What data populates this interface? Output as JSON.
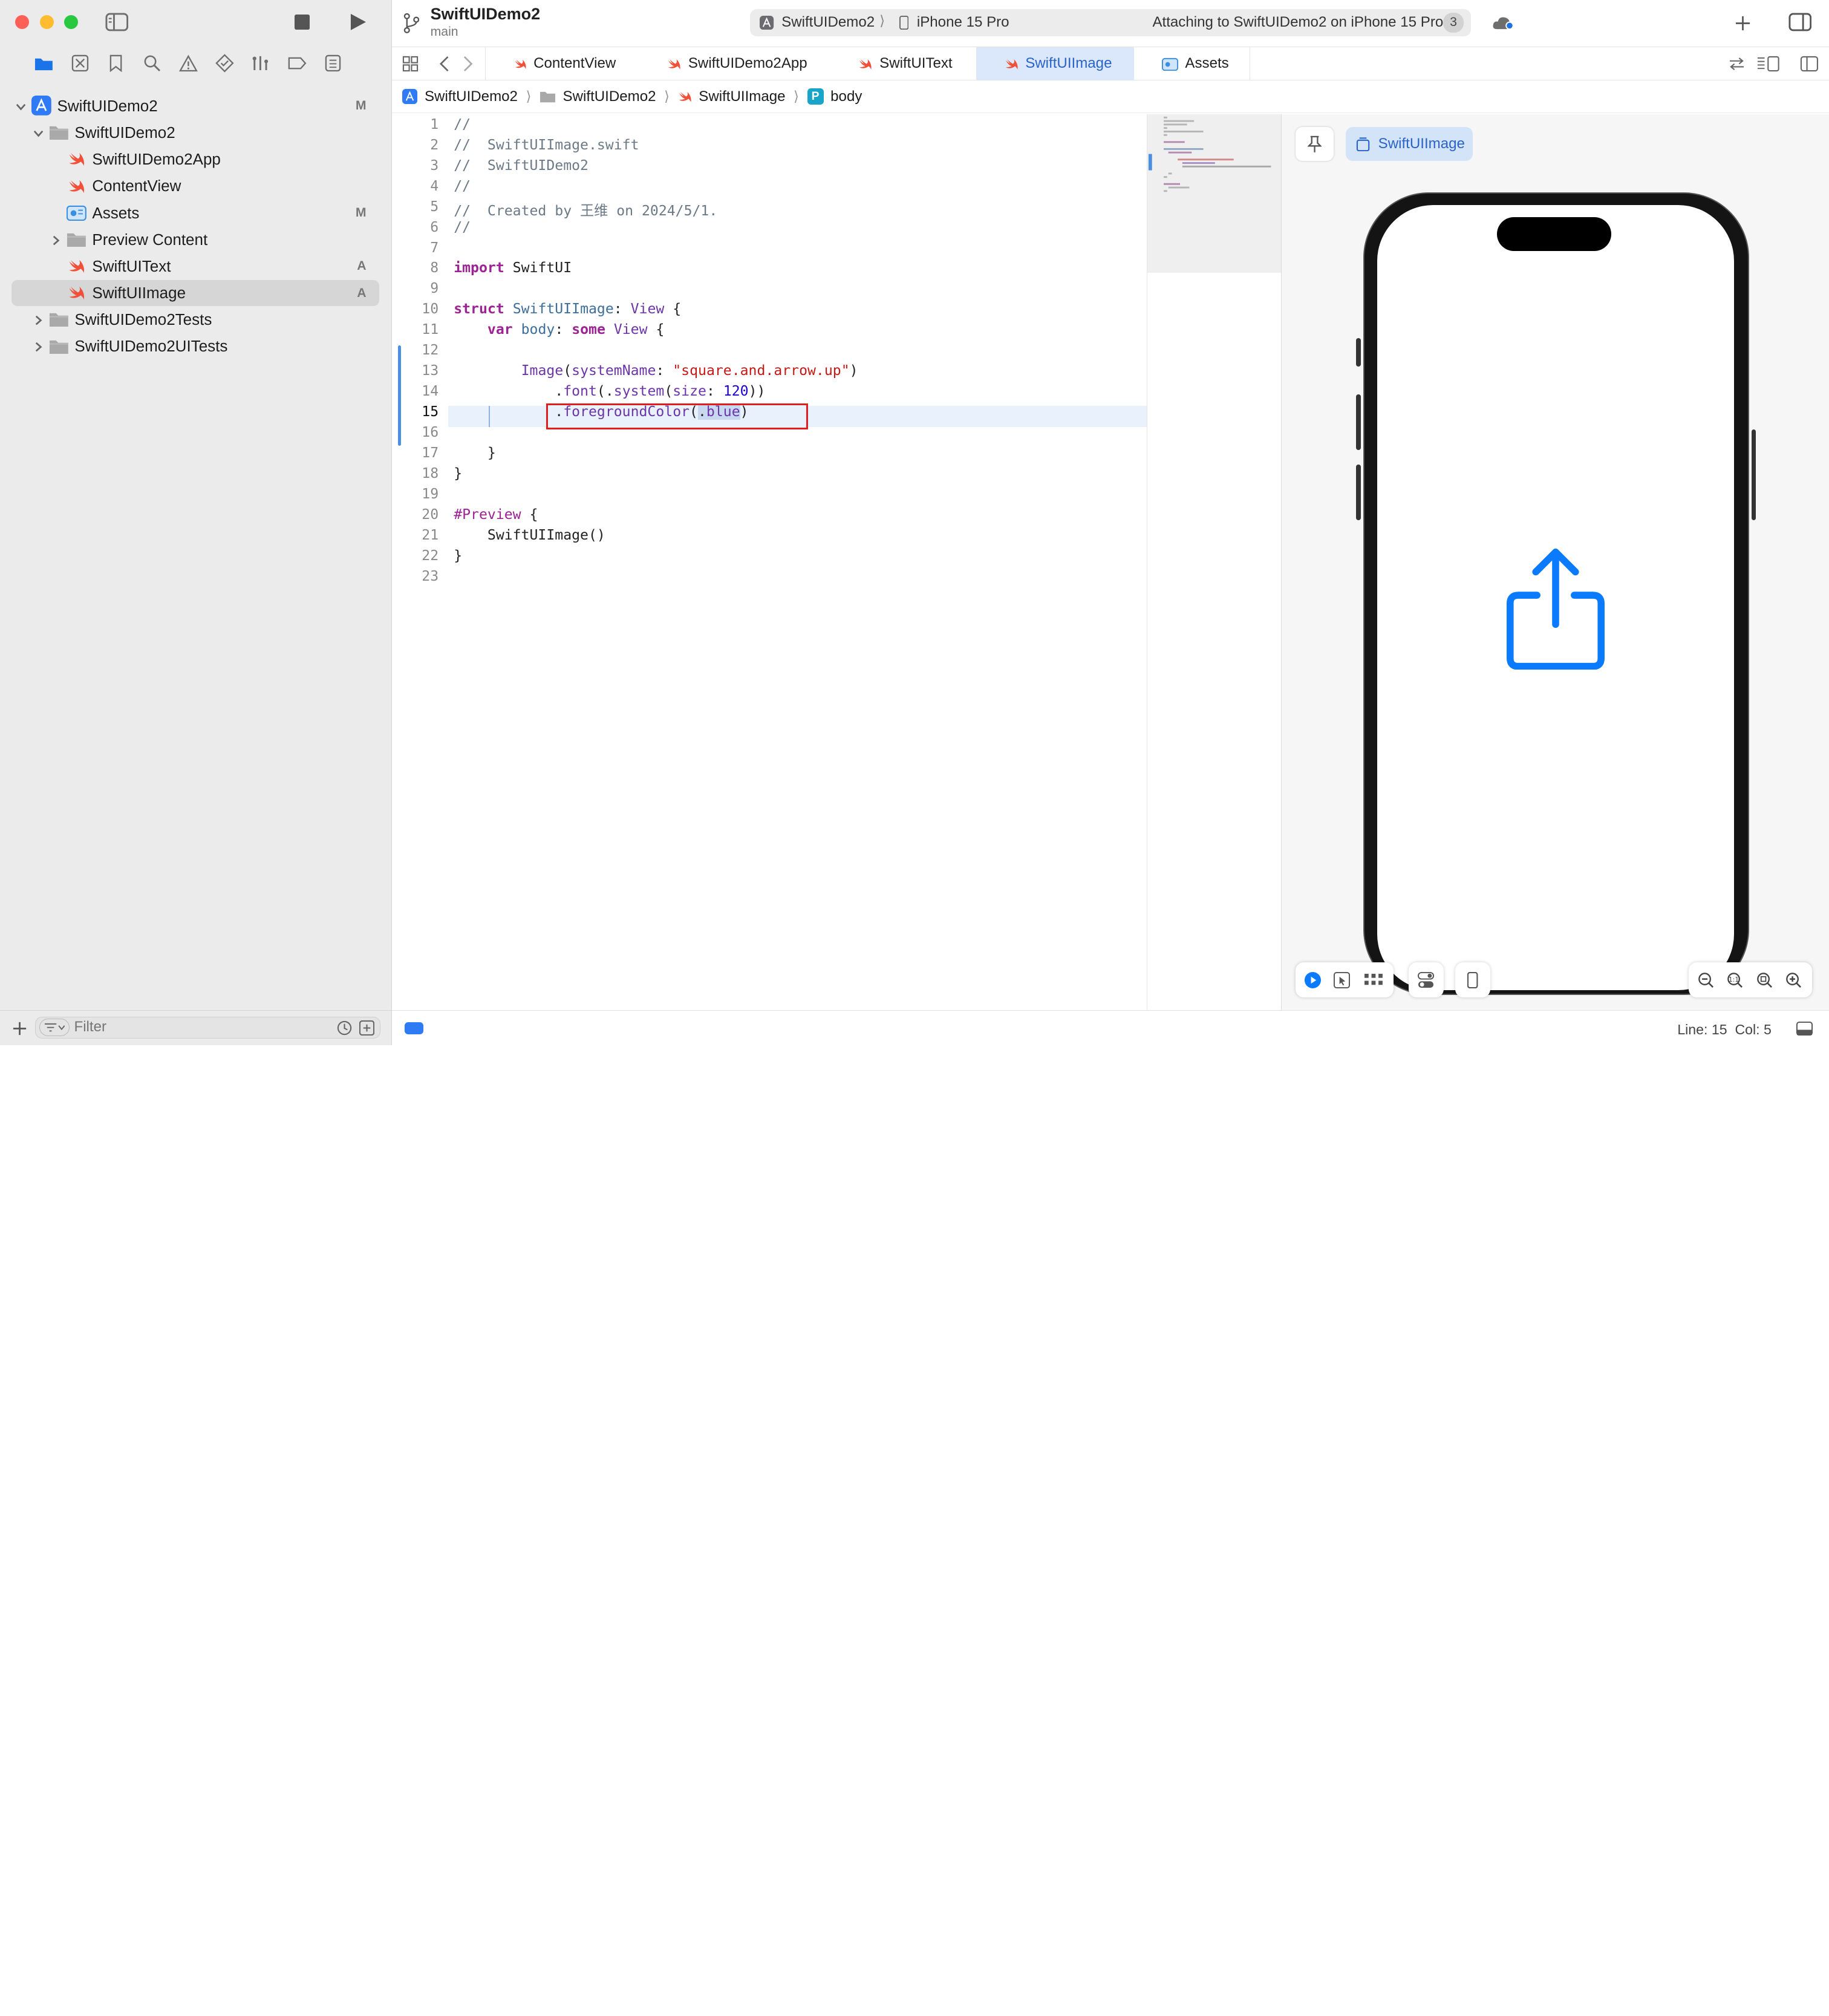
{
  "project": {
    "name": "SwiftUIDemo2",
    "branch": "main"
  },
  "scheme": {
    "target": "SwiftUIDemo2",
    "device": "iPhone 15 Pro",
    "status": "Attaching to SwiftUIDemo2 on iPhone 15 Pro",
    "count": "3"
  },
  "tabs": [
    {
      "label": "ContentView",
      "active": false
    },
    {
      "label": "SwiftUIDemo2App",
      "active": false
    },
    {
      "label": "SwiftUIText",
      "active": false
    },
    {
      "label": "SwiftUIImage",
      "active": true
    },
    {
      "label": "Assets",
      "active": false
    }
  ],
  "breadcrumb": [
    "SwiftUIDemo2",
    "SwiftUIDemo2",
    "SwiftUIImage",
    "body"
  ],
  "navigator": {
    "items": [
      {
        "label": "SwiftUIDemo2",
        "depth": 0,
        "icon": "app-project-icon",
        "disclosure": "open",
        "badge": "M"
      },
      {
        "label": "SwiftUIDemo2",
        "depth": 1,
        "icon": "folder-icon",
        "disclosure": "open",
        "badge": ""
      },
      {
        "label": "SwiftUIDemo2App",
        "depth": 2,
        "icon": "swift-file-icon",
        "disclosure": "none",
        "badge": ""
      },
      {
        "label": "ContentView",
        "depth": 2,
        "icon": "swift-file-icon",
        "disclosure": "none",
        "badge": ""
      },
      {
        "label": "Assets",
        "depth": 2,
        "icon": "assets-icon",
        "disclosure": "none",
        "badge": "M"
      },
      {
        "label": "Preview Content",
        "depth": 2,
        "icon": "folder-icon",
        "disclosure": "closed",
        "badge": ""
      },
      {
        "label": "SwiftUIText",
        "depth": 2,
        "icon": "swift-file-icon",
        "disclosure": "none",
        "badge": "A"
      },
      {
        "label": "SwiftUIImage",
        "depth": 2,
        "icon": "swift-file-icon",
        "disclosure": "none",
        "badge": "A",
        "selected": true
      },
      {
        "label": "SwiftUIDemo2Tests",
        "depth": 1,
        "icon": "folder-icon",
        "disclosure": "closed",
        "badge": ""
      },
      {
        "label": "SwiftUIDemo2UITests",
        "depth": 1,
        "icon": "folder-icon",
        "disclosure": "closed",
        "badge": ""
      }
    ],
    "filter_placeholder": "Filter"
  },
  "editor": {
    "current_line": 15,
    "highlighted_text": ".foregroundColor(.blue)",
    "lines": [
      {
        "n": "1",
        "html": "<span class=\"cm\">//</span>"
      },
      {
        "n": "2",
        "html": "<span class=\"cm\">//  SwiftUIImage.swift</span>"
      },
      {
        "n": "3",
        "html": "<span class=\"cm\">//  SwiftUIDemo2</span>"
      },
      {
        "n": "4",
        "html": "<span class=\"cm\">//</span>"
      },
      {
        "n": "5",
        "html": "<span class=\"cm\">//  Created by 王维 on 2024/5/1.</span>"
      },
      {
        "n": "6",
        "html": "<span class=\"cm\">//</span>"
      },
      {
        "n": "7",
        "html": ""
      },
      {
        "n": "8",
        "html": "<span class=\"kw\">import</span> SwiftUI"
      },
      {
        "n": "9",
        "html": ""
      },
      {
        "n": "10",
        "html": "<span class=\"kw\">struct</span> <span class=\"ty\">SwiftUIImage</span>: <span class=\"fn\">View</span> {"
      },
      {
        "n": "11",
        "html": "    <span class=\"kw\">var</span> <span class=\"ty\">body</span>: <span class=\"kw\">some</span> <span class=\"fn\">View</span> {"
      },
      {
        "n": "12",
        "html": ""
      },
      {
        "n": "13",
        "html": "        <span class=\"fn\">Image</span>(<span class=\"fn\">systemName</span>: <span class=\"st\">\"square.and.arrow.up\"</span>)"
      },
      {
        "n": "14",
        "html": "            .<span class=\"fn\">font</span>(.<span class=\"fn\">system</span>(<span class=\"fn\">size</span>: <span class=\"nm\">120</span>))"
      },
      {
        "n": "15",
        "html": "            .<span class=\"fn\">foregroundColor</span>(<span style=\"background:#c9d8f1\">.<span class=\"fn\">blue</span></span>)"
      },
      {
        "n": "16",
        "html": ""
      },
      {
        "n": "17",
        "html": "    }"
      },
      {
        "n": "18",
        "html": "}"
      },
      {
        "n": "19",
        "html": ""
      },
      {
        "n": "20",
        "html": "<span class=\"pr\">#Preview</span> {"
      },
      {
        "n": "21",
        "html": "    SwiftUIImage()"
      },
      {
        "n": "22",
        "html": "}"
      },
      {
        "n": "23",
        "html": ""
      }
    ]
  },
  "canvas": {
    "preview_label": "SwiftUIImage",
    "accent_color": "#0a7aff",
    "device": "iPhone 15 Pro",
    "rendered_symbol": "square-and-arrow-up-icon"
  },
  "status": {
    "position": "Line: 15  Col: 5"
  }
}
